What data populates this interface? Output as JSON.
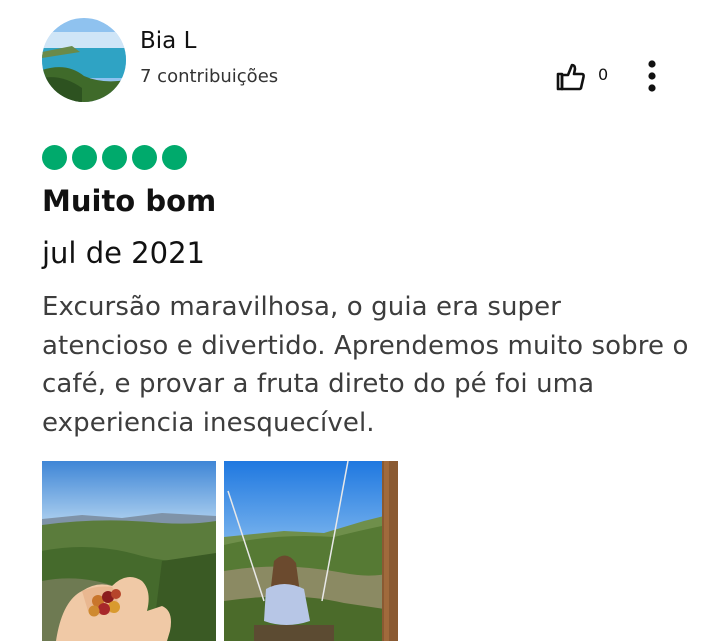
{
  "review": {
    "author_name": "Bia L",
    "contributions": "7 contribuições",
    "like_count": "0",
    "rating": 5,
    "title": "Muito bom",
    "date": "jul de 2021",
    "body": "Excursão maravilhosa, o guia era super atencioso e divertido. Aprendemos muito sobre o café, e provar a fruta direto do pé foi uma experiencia inesquecível."
  },
  "colors": {
    "rating_bubble": "#00aa6c"
  },
  "icons": {
    "like": "thumbs-up-icon",
    "more": "more-vertical-icon"
  }
}
